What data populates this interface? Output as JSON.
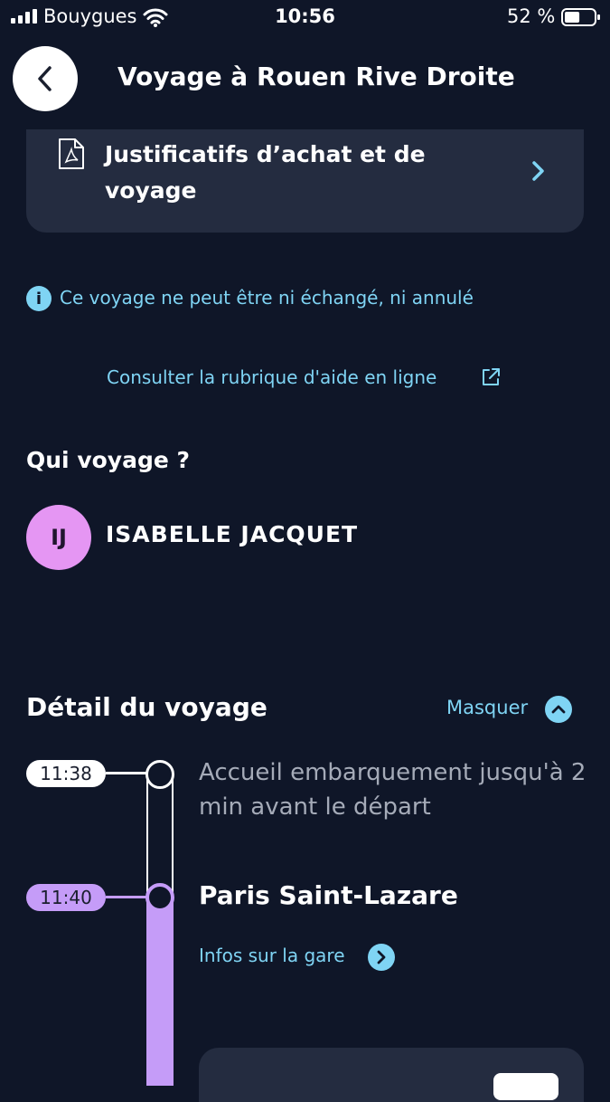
{
  "status_bar": {
    "carrier": "Bouygues",
    "time": "10:56",
    "battery_percent": "52 %",
    "battery_level": 0.52
  },
  "header": {
    "title": "Voyage à Rouen Rive Droite"
  },
  "receipts": {
    "label": "Justificatifs d’achat et de voyage"
  },
  "info": {
    "icon_glyph": "i",
    "text": "Ce voyage ne peut être ni échangé, ni annulé"
  },
  "help": {
    "link_text": "Consulter la rubrique d'aide en ligne"
  },
  "travellers": {
    "title": "Qui voyage ?",
    "items": [
      {
        "initials": "IJ",
        "name": "ISABELLE JACQUET"
      }
    ]
  },
  "trip_detail": {
    "title": "Détail du voyage",
    "toggle_label": "Masquer",
    "timeline": [
      {
        "time": "11:38",
        "text": "Accueil embarquement jusqu'à 2 min avant le départ"
      },
      {
        "time": "11:40",
        "station": "Paris Saint-Lazare",
        "link": "Infos sur la gare"
      }
    ]
  },
  "colors": {
    "background": "#0f1628",
    "card": "#242c40",
    "accent": "#7fd4f4",
    "purple": "#c59cf8",
    "avatar": "#e596f3"
  }
}
